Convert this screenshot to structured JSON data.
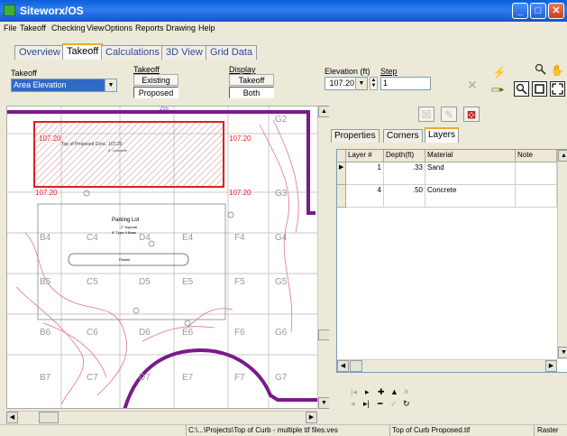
{
  "window": {
    "title": "Siteworx/OS"
  },
  "menu": [
    "File",
    "Takeoff",
    "Checking",
    "View",
    "Options",
    "Reports",
    "Drawing",
    "Help"
  ],
  "tabs": [
    "Overview",
    "Takeoff",
    "Calculations",
    "3D View",
    "Grid Data"
  ],
  "toolbar": {
    "takeoff_label": "Takeoff",
    "takeoff_value": "Area Elevation",
    "takeoff_mode_label": "Takeoff",
    "existing": "Existing",
    "proposed": "Proposed",
    "display_label": "Display",
    "display_takeoff": "Takeoff",
    "display_both": "Both",
    "elevation_label": "Elevation (ft)",
    "elevation_value": "107.20",
    "step_label": "Step",
    "step_value": "1"
  },
  "canvas": {
    "ruler_value": "255",
    "rect_label_top": "Top of Proposed Conc. 107.20",
    "rect_label_sub": "6\" Concrete",
    "elev_tl": "107.20",
    "elev_tr": "107.20",
    "elev_bl": "107.20",
    "elev_br": "107.20",
    "parking_title": "Parking Lot",
    "parking_line1": "2\" Asphalt",
    "parking_line2": "6\" Type II Base",
    "planter": "Planter",
    "grid_labels": [
      "G2",
      "G3",
      "B4",
      "C4",
      "D4",
      "E4",
      "F4",
      "G4",
      "B5",
      "C5",
      "D5",
      "E5",
      "F5",
      "G5",
      "B6",
      "C6",
      "D6",
      "E6",
      "F6",
      "G6",
      "B7",
      "C7",
      "D7",
      "E7",
      "F7",
      "G7"
    ]
  },
  "panel": {
    "tabs": [
      "Properties",
      "Corners",
      "Layers"
    ],
    "columns": [
      "Layer #",
      "Depth(ft)",
      "Material",
      "Note"
    ],
    "rows": [
      {
        "layer": "1",
        "depth": ".33",
        "material": "Sand",
        "note": ""
      },
      {
        "layer": "4",
        "depth": ".50",
        "material": "Concrete",
        "note": ""
      }
    ]
  },
  "status": {
    "path": "C:\\...\\Projects\\Top of Curb - multiple tif files.ves",
    "file": "Top of Curb Proposed.tif",
    "mode": "Raster"
  },
  "colors": {
    "title_bar": "#1c5fd4",
    "boundary": "#7a1a8a",
    "highlight": "#e02020",
    "contour": "#e070a0"
  }
}
